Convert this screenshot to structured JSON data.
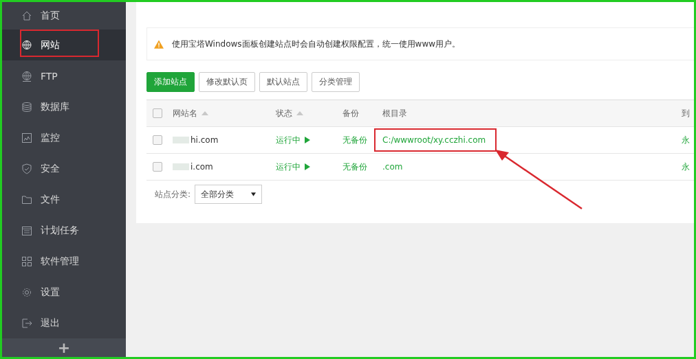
{
  "sidebar": {
    "items": [
      {
        "kind": "home",
        "label": "首页",
        "selected": false,
        "annotated": false
      },
      {
        "kind": "globe",
        "label": "网站",
        "selected": true,
        "annotated": true
      },
      {
        "kind": "ftp",
        "label": "FTP",
        "selected": false,
        "annotated": false
      },
      {
        "kind": "database",
        "label": "数据库",
        "selected": false,
        "annotated": false
      },
      {
        "kind": "monitor",
        "label": "监控",
        "selected": false,
        "annotated": false
      },
      {
        "kind": "shield",
        "label": "安全",
        "selected": false,
        "annotated": false
      },
      {
        "kind": "folder",
        "label": "文件",
        "selected": false,
        "annotated": false
      },
      {
        "kind": "calendar",
        "label": "计划任务",
        "selected": false,
        "annotated": false
      },
      {
        "kind": "grid",
        "label": "软件管理",
        "selected": false,
        "annotated": false
      },
      {
        "kind": "gear",
        "label": "设置",
        "selected": false,
        "annotated": false
      },
      {
        "kind": "logout",
        "label": "退出",
        "selected": false,
        "annotated": false
      }
    ],
    "add_button": "+"
  },
  "notice": "使用宝塔Windows面板创建站点时会自动创建权限配置，统一使用www用户。",
  "buttons": [
    {
      "label": "添加站点",
      "primary": true
    },
    {
      "label": "修改默认页",
      "primary": false
    },
    {
      "label": "默认站点",
      "primary": false
    },
    {
      "label": "分类管理",
      "primary": false
    }
  ],
  "table": {
    "all_checked": false,
    "columns": [
      {
        "label": "网站名",
        "sortable": true
      },
      {
        "label": "状态",
        "sortable": true
      },
      {
        "label": "备份",
        "sortable": false
      },
      {
        "label": "根目录",
        "sortable": false
      },
      {
        "label": "到",
        "sortable": false
      }
    ],
    "rows": [
      {
        "checked": false,
        "name": "hi.com",
        "status": "运行中",
        "backup": "无备份",
        "root": "C:/wwwroot/xy.cczhi.com",
        "root_annotated": true,
        "expiry": "永"
      },
      {
        "checked": false,
        "name": "i.com",
        "status": "运行中",
        "backup": "无备份",
        "root": ".com",
        "root_annotated": false,
        "expiry": "永"
      }
    ]
  },
  "filter": {
    "label": "站点分类:",
    "value": "全部分类"
  }
}
